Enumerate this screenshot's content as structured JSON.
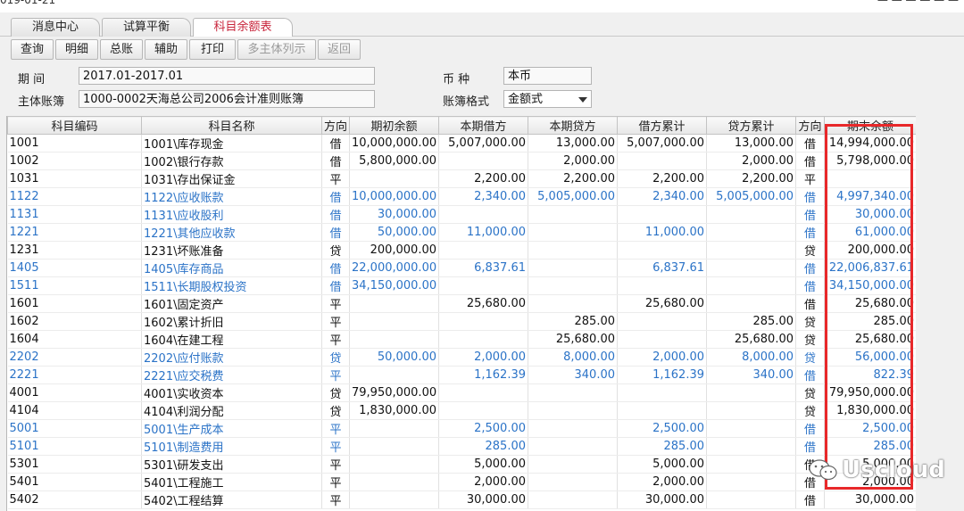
{
  "top": {
    "date": "019-01-21",
    "right_text": "— — — — — —"
  },
  "tabs": [
    {
      "label": "消息中心"
    },
    {
      "label": "试算平衡"
    },
    {
      "label": "科目余额表"
    }
  ],
  "toolbar": {
    "buttons": [
      {
        "label": "查询"
      },
      {
        "label": "明细"
      },
      {
        "label": "总账"
      },
      {
        "label": "辅助"
      },
      {
        "label": "打印"
      },
      {
        "label": "多主体列示"
      },
      {
        "label": "返回"
      }
    ]
  },
  "form": {
    "period_label": "期 间",
    "period_value": "2017.01-2017.01",
    "currency_label": "币 种",
    "currency_value": "本币",
    "entity_label": "主体账簿",
    "entity_value": "1000-0002天海总公司2006会计准则账簿",
    "format_label": "账簿格式",
    "format_value": "金额式"
  },
  "table": {
    "headers": [
      "科目编码",
      "科目名称",
      "方向",
      "期初余额",
      "本期借方",
      "本期贷方",
      "借方累计",
      "贷方累计",
      "方向",
      "期末余额"
    ],
    "rows": [
      {
        "blue": false,
        "cells": [
          "1001",
          "1001\\库存现金",
          "借",
          "10,000,000.00",
          "5,007,000.00",
          "13,000.00",
          "5,007,000.00",
          "13,000.00",
          "借",
          "14,994,000.00"
        ]
      },
      {
        "blue": false,
        "cells": [
          "1002",
          "1002\\银行存款",
          "借",
          "5,800,000.00",
          "",
          "2,000.00",
          "",
          "2,000.00",
          "借",
          "5,798,000.00"
        ]
      },
      {
        "blue": false,
        "cells": [
          "1031",
          "1031\\存出保证金",
          "平",
          "",
          "2,200.00",
          "2,200.00",
          "2,200.00",
          "2,200.00",
          "平",
          ""
        ]
      },
      {
        "blue": true,
        "cells": [
          "1122",
          "1122\\应收账款",
          "借",
          "10,000,000.00",
          "2,340.00",
          "5,005,000.00",
          "2,340.00",
          "5,005,000.00",
          "借",
          "4,997,340.00"
        ]
      },
      {
        "blue": true,
        "cells": [
          "1131",
          "1131\\应收股利",
          "借",
          "30,000.00",
          "",
          "",
          "",
          "",
          "借",
          "30,000.00"
        ]
      },
      {
        "blue": true,
        "cells": [
          "1221",
          "1221\\其他应收款",
          "借",
          "50,000.00",
          "11,000.00",
          "",
          "11,000.00",
          "",
          "借",
          "61,000.00"
        ]
      },
      {
        "blue": false,
        "cells": [
          "1231",
          "1231\\坏账准备",
          "贷",
          "200,000.00",
          "",
          "",
          "",
          "",
          "贷",
          "200,000.00"
        ]
      },
      {
        "blue": true,
        "cells": [
          "1405",
          "1405\\库存商品",
          "借",
          "22,000,000.00",
          "6,837.61",
          "",
          "6,837.61",
          "",
          "借",
          "22,006,837.61"
        ]
      },
      {
        "blue": true,
        "cells": [
          "1511",
          "1511\\长期股权投资",
          "借",
          "34,150,000.00",
          "",
          "",
          "",
          "",
          "借",
          "34,150,000.00"
        ]
      },
      {
        "blue": false,
        "cells": [
          "1601",
          "1601\\固定资产",
          "平",
          "",
          "25,680.00",
          "",
          "25,680.00",
          "",
          "借",
          "25,680.00"
        ]
      },
      {
        "blue": false,
        "cells": [
          "1602",
          "1602\\累计折旧",
          "平",
          "",
          "",
          "285.00",
          "",
          "285.00",
          "贷",
          "285.00"
        ]
      },
      {
        "blue": false,
        "cells": [
          "1604",
          "1604\\在建工程",
          "平",
          "",
          "",
          "25,680.00",
          "",
          "25,680.00",
          "贷",
          "25,680.00"
        ]
      },
      {
        "blue": true,
        "cells": [
          "2202",
          "2202\\应付账款",
          "贷",
          "50,000.00",
          "2,000.00",
          "8,000.00",
          "2,000.00",
          "8,000.00",
          "贷",
          "56,000.00"
        ]
      },
      {
        "blue": true,
        "cells": [
          "2221",
          "2221\\应交税费",
          "平",
          "",
          "1,162.39",
          "340.00",
          "1,162.39",
          "340.00",
          "借",
          "822.39"
        ]
      },
      {
        "blue": false,
        "cells": [
          "4001",
          "4001\\实收资本",
          "贷",
          "79,950,000.00",
          "",
          "",
          "",
          "",
          "贷",
          "79,950,000.00"
        ]
      },
      {
        "blue": false,
        "cells": [
          "4104",
          "4104\\利润分配",
          "贷",
          "1,830,000.00",
          "",
          "",
          "",
          "",
          "贷",
          "1,830,000.00"
        ]
      },
      {
        "blue": true,
        "cells": [
          "5001",
          "5001\\生产成本",
          "平",
          "",
          "2,500.00",
          "",
          "2,500.00",
          "",
          "借",
          "2,500.00"
        ]
      },
      {
        "blue": true,
        "cells": [
          "5101",
          "5101\\制造费用",
          "平",
          "",
          "285.00",
          "",
          "285.00",
          "",
          "借",
          "285.00"
        ]
      },
      {
        "blue": false,
        "cells": [
          "5301",
          "5301\\研发支出",
          "平",
          "",
          "5,000.00",
          "",
          "5,000.00",
          "",
          "借",
          "5,000.00"
        ]
      },
      {
        "blue": false,
        "cells": [
          "5401",
          "5401\\工程施工",
          "平",
          "",
          "2,000.00",
          "",
          "2,000.00",
          "",
          "借",
          "2,000.00"
        ]
      },
      {
        "blue": false,
        "cells": [
          "5402",
          "5402\\工程结算",
          "平",
          "",
          "30,000.00",
          "",
          "30,000.00",
          "",
          "借",
          "30,000.00"
        ]
      }
    ]
  },
  "highlight_color": "#e8282a",
  "link_color": "#2b73c7",
  "watermark": {
    "text": "Uscloud",
    "icon": "wechat-logo-icon"
  }
}
